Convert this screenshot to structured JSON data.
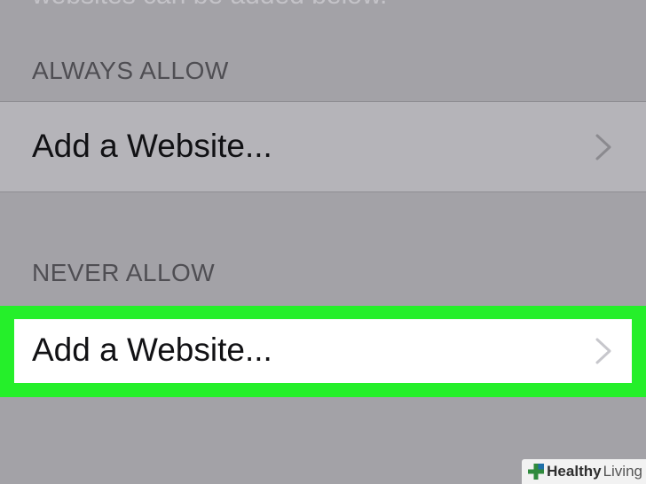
{
  "top_text": "websites can be added below.",
  "sections": {
    "always": {
      "header": "ALWAYS ALLOW",
      "row_label": "Add a Website..."
    },
    "never": {
      "header": "NEVER ALLOW",
      "row_label": "Add a Website..."
    }
  },
  "icons": {
    "chevron": "chevron-right-icon",
    "watermark_logo": "plus-leaf-icon"
  },
  "watermark": {
    "brand_bold": "Healthy",
    "brand_light": "Living"
  },
  "colors": {
    "background": "#a3a2a7",
    "highlight": "#25ef2a",
    "row_dim": "#b5b4b9",
    "row_active": "#ffffff"
  }
}
